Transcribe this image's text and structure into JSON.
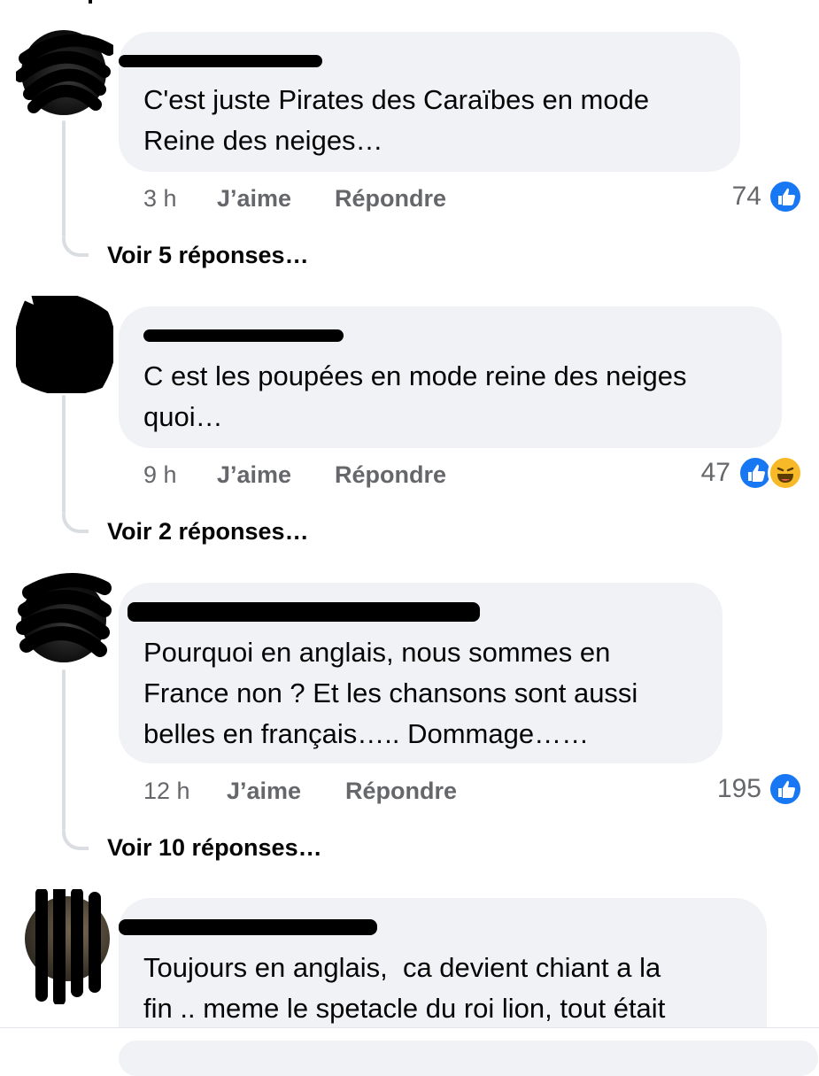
{
  "comments": [
    {
      "text": "C'est juste Pirates des Caraïbes en mode\nReine des neiges…",
      "time": "3 h",
      "like_label": "J’aime",
      "reply_label": "Répondre",
      "reaction_count": "74",
      "reactions": [
        "like-icon"
      ],
      "view_replies": "Voir 5 réponses…"
    },
    {
      "text": "C est les poupées en mode reine des neiges\nquoi…",
      "time": "9 h",
      "like_label": "J’aime",
      "reply_label": "Répondre",
      "reaction_count": "47",
      "reactions": [
        "like-icon",
        "haha-icon"
      ],
      "view_replies": "Voir 2 réponses…"
    },
    {
      "text": "Pourquoi en anglais, nous sommes en\nFrance non ? Et les chansons sont aussi\nbelles en français….. Dommage……",
      "time": "12 h",
      "like_label": "J’aime",
      "reply_label": "Répondre",
      "reaction_count": "195",
      "reactions": [
        "like-icon"
      ],
      "view_replies": "Voir 10 réponses…"
    },
    {
      "text": "Toujours en anglais,  ca devient chiant a la\nfin .. meme le spetacle du roi lion, tout était"
    }
  ],
  "colors": {
    "like_blue": "#1877f2",
    "haha_yellow": "#f7b928",
    "bubble_bg": "#f0f2f5",
    "meta_gray": "#65676b"
  }
}
